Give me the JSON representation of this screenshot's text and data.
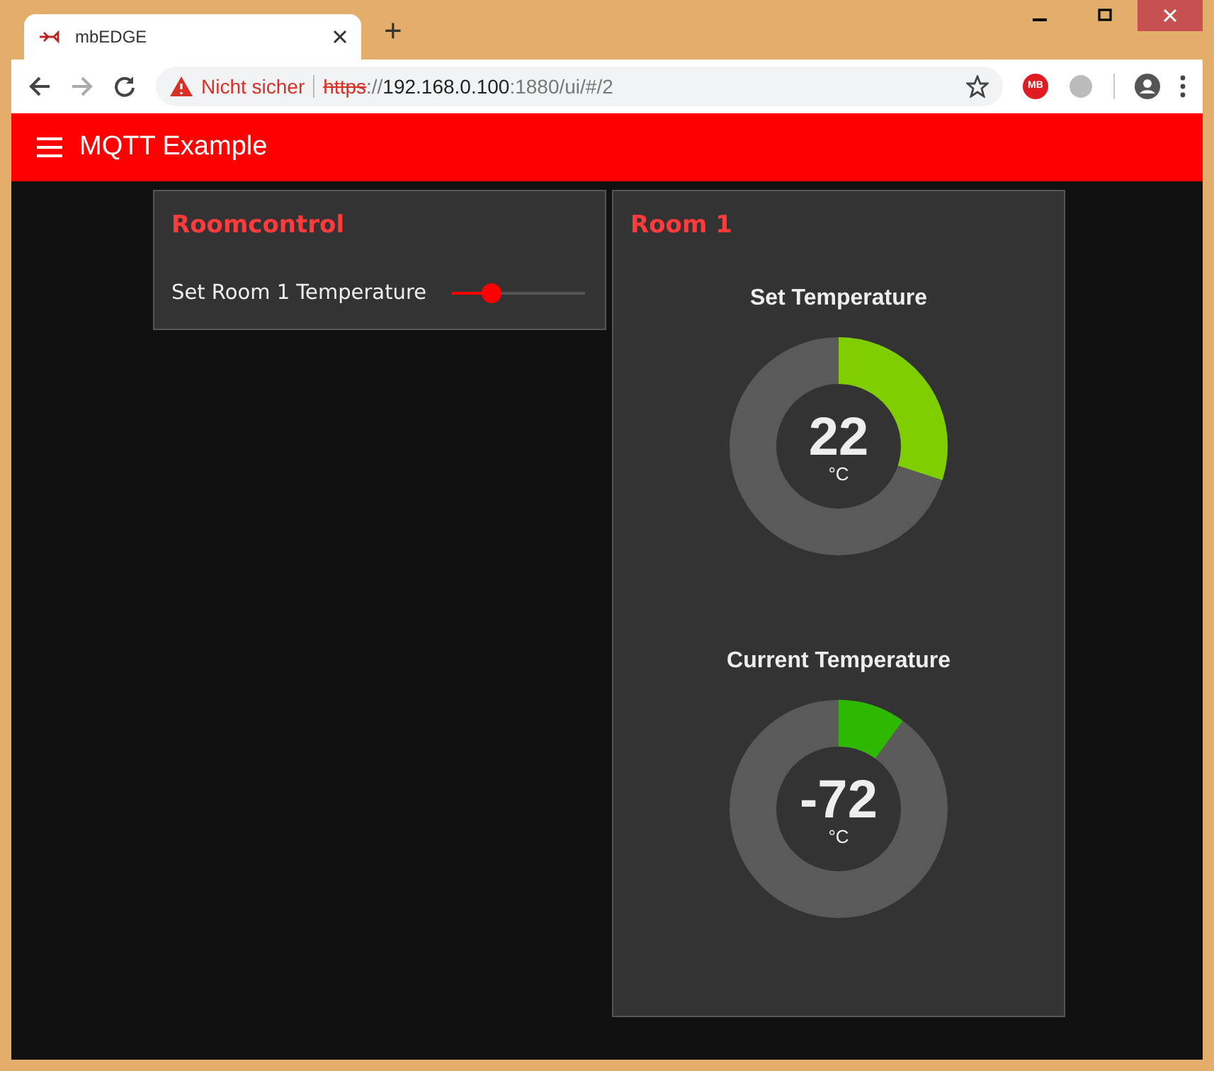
{
  "browser": {
    "tab_title": "mbEDGE",
    "new_tab": "+",
    "security": "Nicht sicher",
    "url": {
      "scheme": "https",
      "separator": "://",
      "host": "192.168.0.100",
      "rest": ":1880/ui/#/2"
    },
    "extension_badge": "MB"
  },
  "app": {
    "title": "MQTT Example"
  },
  "roomcontrol": {
    "title": "Roomcontrol",
    "slider": {
      "label": "Set Room 1 Temperature",
      "level": 0.3
    }
  },
  "room": {
    "title": "Room 1",
    "gauges": [
      {
        "title": "Set Temperature",
        "value": "22",
        "unit": "°C",
        "level": 0.3,
        "color": "#7fcf00"
      },
      {
        "title": "Current Temperature",
        "value": "-72",
        "unit": "°C",
        "level": 0.1,
        "color": "#2eb800"
      }
    ]
  }
}
